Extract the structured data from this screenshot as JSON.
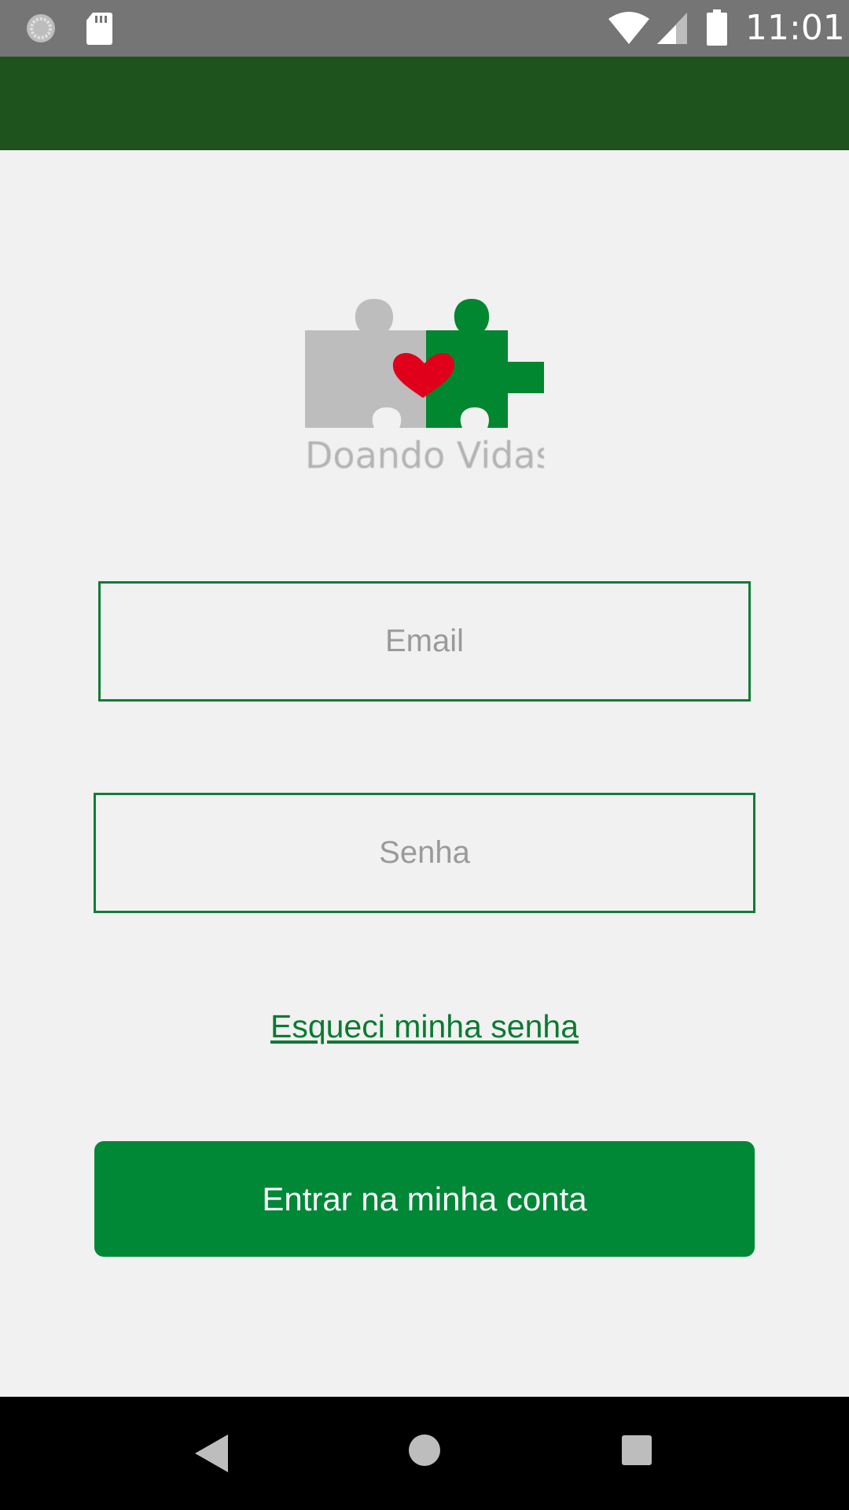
{
  "status_bar": {
    "time": "11:01",
    "icons": [
      "sync-icon",
      "sd-card-icon",
      "wifi-icon",
      "signal-icon",
      "battery-icon"
    ]
  },
  "app": {
    "logo_text": "Doando Vidas",
    "colors": {
      "app_bar": "#1e531e",
      "accent": "#008837",
      "link": "#0b7a32",
      "field_border": "#0f7d34",
      "background": "#f1f1f1",
      "heart": "#e0001b",
      "puzzle_gray": "#bdbdbd",
      "puzzle_green": "#00872f"
    }
  },
  "form": {
    "email_placeholder": "Email",
    "email_value": "",
    "password_placeholder": "Senha",
    "password_value": "",
    "forgot_label": "Esqueci minha senha",
    "login_label": "Entrar na minha conta"
  },
  "nav_bar": {
    "icons": [
      "back-icon",
      "home-icon",
      "recents-icon"
    ]
  }
}
